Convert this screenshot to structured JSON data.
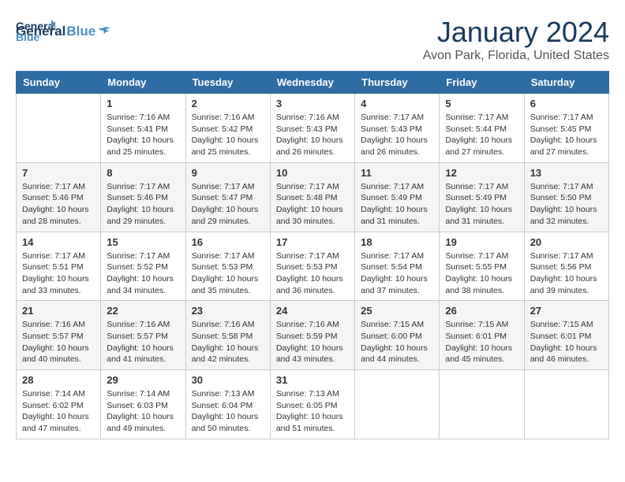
{
  "header": {
    "logo_general": "General",
    "logo_blue": "Blue",
    "month_year": "January 2024",
    "location": "Avon Park, Florida, United States"
  },
  "weekdays": [
    "Sunday",
    "Monday",
    "Tuesday",
    "Wednesday",
    "Thursday",
    "Friday",
    "Saturday"
  ],
  "weeks": [
    [
      {
        "day": "",
        "sunrise": "",
        "sunset": "",
        "daylight": ""
      },
      {
        "day": "1",
        "sunrise": "Sunrise: 7:16 AM",
        "sunset": "Sunset: 5:41 PM",
        "daylight": "Daylight: 10 hours and 25 minutes."
      },
      {
        "day": "2",
        "sunrise": "Sunrise: 7:16 AM",
        "sunset": "Sunset: 5:42 PM",
        "daylight": "Daylight: 10 hours and 25 minutes."
      },
      {
        "day": "3",
        "sunrise": "Sunrise: 7:16 AM",
        "sunset": "Sunset: 5:43 PM",
        "daylight": "Daylight: 10 hours and 26 minutes."
      },
      {
        "day": "4",
        "sunrise": "Sunrise: 7:17 AM",
        "sunset": "Sunset: 5:43 PM",
        "daylight": "Daylight: 10 hours and 26 minutes."
      },
      {
        "day": "5",
        "sunrise": "Sunrise: 7:17 AM",
        "sunset": "Sunset: 5:44 PM",
        "daylight": "Daylight: 10 hours and 27 minutes."
      },
      {
        "day": "6",
        "sunrise": "Sunrise: 7:17 AM",
        "sunset": "Sunset: 5:45 PM",
        "daylight": "Daylight: 10 hours and 27 minutes."
      }
    ],
    [
      {
        "day": "7",
        "sunrise": "Sunrise: 7:17 AM",
        "sunset": "Sunset: 5:46 PM",
        "daylight": "Daylight: 10 hours and 28 minutes."
      },
      {
        "day": "8",
        "sunrise": "Sunrise: 7:17 AM",
        "sunset": "Sunset: 5:46 PM",
        "daylight": "Daylight: 10 hours and 29 minutes."
      },
      {
        "day": "9",
        "sunrise": "Sunrise: 7:17 AM",
        "sunset": "Sunset: 5:47 PM",
        "daylight": "Daylight: 10 hours and 29 minutes."
      },
      {
        "day": "10",
        "sunrise": "Sunrise: 7:17 AM",
        "sunset": "Sunset: 5:48 PM",
        "daylight": "Daylight: 10 hours and 30 minutes."
      },
      {
        "day": "11",
        "sunrise": "Sunrise: 7:17 AM",
        "sunset": "Sunset: 5:49 PM",
        "daylight": "Daylight: 10 hours and 31 minutes."
      },
      {
        "day": "12",
        "sunrise": "Sunrise: 7:17 AM",
        "sunset": "Sunset: 5:49 PM",
        "daylight": "Daylight: 10 hours and 31 minutes."
      },
      {
        "day": "13",
        "sunrise": "Sunrise: 7:17 AM",
        "sunset": "Sunset: 5:50 PM",
        "daylight": "Daylight: 10 hours and 32 minutes."
      }
    ],
    [
      {
        "day": "14",
        "sunrise": "Sunrise: 7:17 AM",
        "sunset": "Sunset: 5:51 PM",
        "daylight": "Daylight: 10 hours and 33 minutes."
      },
      {
        "day": "15",
        "sunrise": "Sunrise: 7:17 AM",
        "sunset": "Sunset: 5:52 PM",
        "daylight": "Daylight: 10 hours and 34 minutes."
      },
      {
        "day": "16",
        "sunrise": "Sunrise: 7:17 AM",
        "sunset": "Sunset: 5:53 PM",
        "daylight": "Daylight: 10 hours and 35 minutes."
      },
      {
        "day": "17",
        "sunrise": "Sunrise: 7:17 AM",
        "sunset": "Sunset: 5:53 PM",
        "daylight": "Daylight: 10 hours and 36 minutes."
      },
      {
        "day": "18",
        "sunrise": "Sunrise: 7:17 AM",
        "sunset": "Sunset: 5:54 PM",
        "daylight": "Daylight: 10 hours and 37 minutes."
      },
      {
        "day": "19",
        "sunrise": "Sunrise: 7:17 AM",
        "sunset": "Sunset: 5:55 PM",
        "daylight": "Daylight: 10 hours and 38 minutes."
      },
      {
        "day": "20",
        "sunrise": "Sunrise: 7:17 AM",
        "sunset": "Sunset: 5:56 PM",
        "daylight": "Daylight: 10 hours and 39 minutes."
      }
    ],
    [
      {
        "day": "21",
        "sunrise": "Sunrise: 7:16 AM",
        "sunset": "Sunset: 5:57 PM",
        "daylight": "Daylight: 10 hours and 40 minutes."
      },
      {
        "day": "22",
        "sunrise": "Sunrise: 7:16 AM",
        "sunset": "Sunset: 5:57 PM",
        "daylight": "Daylight: 10 hours and 41 minutes."
      },
      {
        "day": "23",
        "sunrise": "Sunrise: 7:16 AM",
        "sunset": "Sunset: 5:58 PM",
        "daylight": "Daylight: 10 hours and 42 minutes."
      },
      {
        "day": "24",
        "sunrise": "Sunrise: 7:16 AM",
        "sunset": "Sunset: 5:59 PM",
        "daylight": "Daylight: 10 hours and 43 minutes."
      },
      {
        "day": "25",
        "sunrise": "Sunrise: 7:15 AM",
        "sunset": "Sunset: 6:00 PM",
        "daylight": "Daylight: 10 hours and 44 minutes."
      },
      {
        "day": "26",
        "sunrise": "Sunrise: 7:15 AM",
        "sunset": "Sunset: 6:01 PM",
        "daylight": "Daylight: 10 hours and 45 minutes."
      },
      {
        "day": "27",
        "sunrise": "Sunrise: 7:15 AM",
        "sunset": "Sunset: 6:01 PM",
        "daylight": "Daylight: 10 hours and 46 minutes."
      }
    ],
    [
      {
        "day": "28",
        "sunrise": "Sunrise: 7:14 AM",
        "sunset": "Sunset: 6:02 PM",
        "daylight": "Daylight: 10 hours and 47 minutes."
      },
      {
        "day": "29",
        "sunrise": "Sunrise: 7:14 AM",
        "sunset": "Sunset: 6:03 PM",
        "daylight": "Daylight: 10 hours and 49 minutes."
      },
      {
        "day": "30",
        "sunrise": "Sunrise: 7:13 AM",
        "sunset": "Sunset: 6:04 PM",
        "daylight": "Daylight: 10 hours and 50 minutes."
      },
      {
        "day": "31",
        "sunrise": "Sunrise: 7:13 AM",
        "sunset": "Sunset: 6:05 PM",
        "daylight": "Daylight: 10 hours and 51 minutes."
      },
      {
        "day": "",
        "sunrise": "",
        "sunset": "",
        "daylight": ""
      },
      {
        "day": "",
        "sunrise": "",
        "sunset": "",
        "daylight": ""
      },
      {
        "day": "",
        "sunrise": "",
        "sunset": "",
        "daylight": ""
      }
    ]
  ]
}
